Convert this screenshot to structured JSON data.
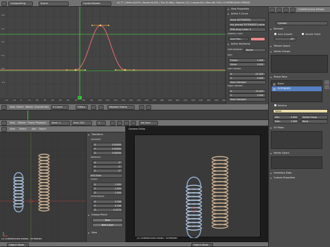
{
  "top_header": {
    "layout": "Compositing",
    "scene": "Scene",
    "engine": "Cycles Render",
    "info": "v2.77 | Verts:16,074 | Faces:16,032 | Tris:32,064 | Objects:1/2 | Lamps:0/0 | Mem:65.72M | COMPRESSION SPRING"
  },
  "graph_editor": {
    "header": {
      "view": "View",
      "select": "Select",
      "marker": "Marker",
      "channel": "Channel",
      "key": "Key",
      "mode": "F-Curve",
      "filters": "Filters",
      "auto_snap": "Nearest Frame"
    },
    "x_ticks": [
      "-20",
      "-10",
      "0",
      "10",
      "20",
      "30",
      "40",
      "50",
      "60",
      "70",
      "80",
      "90",
      "100",
      "110",
      "120",
      "130",
      "140",
      "150",
      "160",
      "170",
      "180",
      "190",
      "200",
      "210",
      "220",
      "230",
      "240",
      "250",
      "260"
    ],
    "y_ticks": [
      "0.8",
      "0.6",
      "0.4",
      "0.2",
      "0.0",
      "-0.2"
    ],
    "current_frame": "1"
  },
  "fcurve_panel": {
    "view_properties": "View Properties",
    "active_fcurve": "Active F-Curve",
    "channel_name": "Value (EXTENDED)",
    "rna_path": "key_blocks[\"EXTENDED\"].value",
    "array_index": "RNA Array Index: 0",
    "display_color": "Display Color:",
    "color_mode": "Auto Rain...",
    "active_keyframe": "Active Keyframe",
    "interpolation_label": "Interpolation:",
    "interpolation": "Bezier",
    "key_label": "Key:",
    "key_frame": "Frame:",
    "key_frame_val": "1.000",
    "key_value": "Value:",
    "key_value_val": "0.000",
    "left_handle": "Left Handle:",
    "lh_x": "X:",
    "lh_x_val": "-22.420",
    "lh_y": "Y:",
    "lh_y_val": "0.000",
    "lh_type": "Auto Clamped",
    "right_handle": "Right Handle:",
    "rh_x": "X:",
    "rh_x_val": "24.420",
    "rh_y": "Y:",
    "rh_y_val": "0.000",
    "rh_type": "Auto Clamped"
  },
  "timeline": {
    "view": "View",
    "marker": "Marker",
    "frame": "Frame",
    "playback": "Playback",
    "start_label": "Start:",
    "start": "1",
    "end_label": "End:",
    "end": "250",
    "current": "1",
    "sync": "No Sync"
  },
  "properties": {
    "object_name": "Cylinder",
    "tab_label": "COMPRESSION SPRING",
    "normals": "Normals",
    "auto_smooth": "Auto Smooth",
    "double_sided": "Double Sided",
    "angle": "30°",
    "texture_space": "Texture Space",
    "vertex_groups": "Vertex Groups",
    "shape_keys": "Shape Keys",
    "shape_key_items": [
      "Basis",
      "EXTENDED"
    ],
    "relative": "Relative",
    "value_label": "Value:",
    "range_min": "Min:",
    "range_min_val": "0.000",
    "range_max": "Max:",
    "range_max_val": "1.000",
    "vertex_group": "Vertex Group",
    "relative_to": "Basis",
    "uv_maps": "UV Maps",
    "vertex_colors": "Vertex Colors",
    "geometry_data": "Geometry Data",
    "custom_properties": "Custom Properties"
  },
  "viewport_left": {
    "header": {
      "view": "View",
      "select": "Select",
      "add": "Add",
      "object": "Object"
    },
    "footer": {
      "mode": "Object Mode",
      "label": "(1) COMPRESSION SPRING : EXTENDED"
    }
  },
  "n_panel": {
    "transform": "Transform",
    "location": "Location:",
    "loc_x": "X:",
    "loc_x_val": "0.00000",
    "loc_y": "Y:",
    "loc_y_val": "0.00000",
    "loc_z": "Z:",
    "loc_z_val": "0.00000",
    "rotation": "Rotation:",
    "rot_x": "X:",
    "rot_x_val": "0°",
    "rot_y": "Y:",
    "rot_y_val": "0°",
    "rot_z": "Z:",
    "rot_z_val": "0°",
    "rot_mode": "XYZ Euler",
    "scale": "Scale:",
    "sc_x": "X:",
    "sc_x_val": "1.000",
    "sc_y": "Y:",
    "sc_y_val": "1.000",
    "sc_z": "Z:",
    "sc_z_val": "1.000",
    "dimensions": "Dimensions:",
    "dim_x": "X:",
    "dim_x_val": "0.346",
    "dim_y": "Y:",
    "dim_y_val": "0.346",
    "dim_z": "Z:",
    "dim_z_val": "0.1572",
    "grease_pencil": "Grease Pencil",
    "new": "New",
    "new_layer": "New Layer",
    "view": "View"
  },
  "viewport_right": {
    "title": "Camera Ortho",
    "footer": {
      "mode": "Object Mode",
      "label": "(1) COMPRESSION SPRING : EXTENDED"
    }
  },
  "colors": {
    "curve": "#e06a6a",
    "handle": "#f0a050",
    "selected_row": "#5680c2",
    "value_strip": "#e8dca8"
  }
}
